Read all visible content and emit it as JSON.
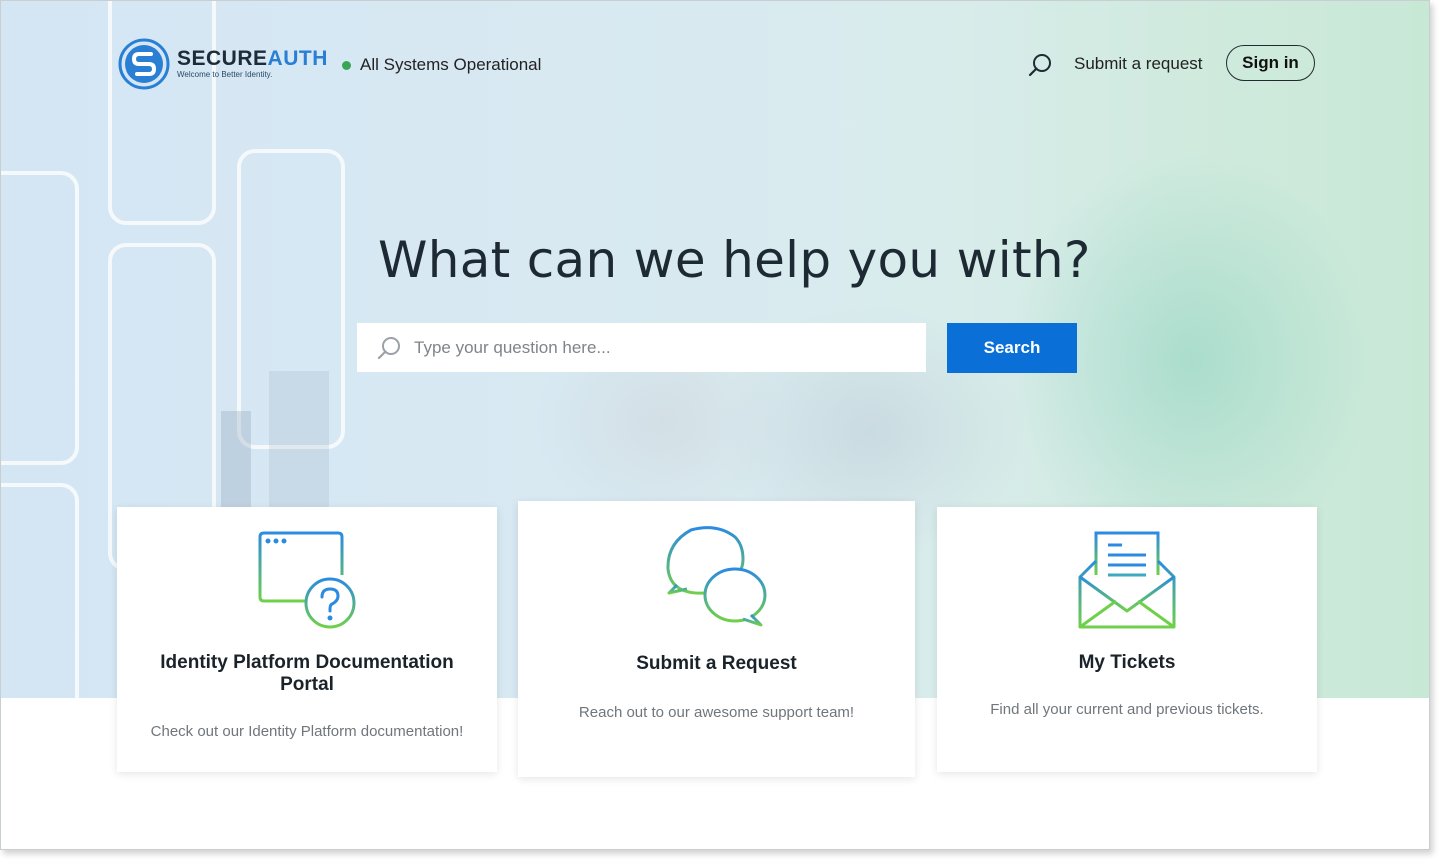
{
  "brand": {
    "name_part1": "SECURE",
    "name_part2": "AUTH",
    "tagline": "Welcome to Better Identity.",
    "accent_color": "#2a7fd4"
  },
  "status": {
    "text": "All Systems Operational",
    "color": "#3aa655"
  },
  "nav": {
    "search_icon": "search-icon",
    "submit_request": "Submit a request",
    "sign_in": "Sign in"
  },
  "hero": {
    "headline": "What can we help you with?",
    "search_placeholder": "Type your question here...",
    "search_button": "Search",
    "button_color": "#0b6fd8"
  },
  "cards": [
    {
      "icon": "browser-question-icon",
      "title": "Identity Platform Documentation Portal",
      "description": "Check out our Identity Platform documentation!"
    },
    {
      "icon": "chat-bubbles-icon",
      "title": "Submit a Request",
      "description": "Reach out to our awesome support team!"
    },
    {
      "icon": "envelope-letter-icon",
      "title": "My Tickets",
      "description": "Find all your current and previous tickets."
    }
  ]
}
